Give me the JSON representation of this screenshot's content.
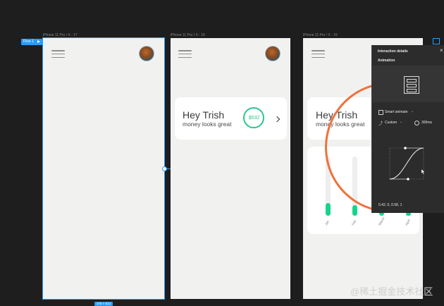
{
  "canvas": {
    "flow_label": "Flow 1",
    "frames": [
      {
        "label": "iPhone 11 Pro / X - 17",
        "size_label": "375 × 812"
      },
      {
        "label": "iPhone 11 Pro / X - 16"
      },
      {
        "label": "iPhone 11 Pro / X - 15"
      }
    ]
  },
  "card": {
    "greeting": "Hey Trish",
    "subtitle": "money looks great",
    "amount": "$532"
  },
  "chart_data": {
    "type": "bar",
    "categories": [
      "Jan",
      "Feb",
      "March",
      "April"
    ],
    "values": [
      0.22,
      0.18,
      0.08,
      0.06
    ],
    "ylim": [
      0,
      1
    ]
  },
  "panel": {
    "title": "Interaction details",
    "section": "Animation",
    "animation_type": "Smart animate",
    "easing": "Custom",
    "duration": "300ms",
    "bezier_values": "0.42, 0, 0.58, 1"
  },
  "watermark": "@稀土掘金技术社区",
  "colors": {
    "accent": "#18d38c",
    "highlight": "#f0713a",
    "selection": "#2e9bf0"
  }
}
